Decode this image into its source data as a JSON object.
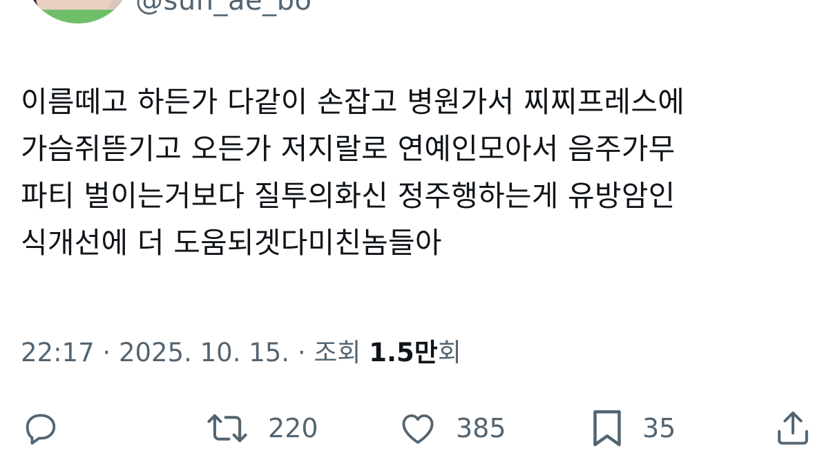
{
  "author": {
    "handle": "@sun_ae_bo"
  },
  "tweet": {
    "lines": [
      "이름떼고 하든가 다같이 손잡고 병원가서 찌찌프레스에",
      "가슴쥐뜯기고 오든가 저지랄로 연예인모아서 음주가무",
      "파티 벌이는거보다 질투의화신 정주행하는게 유방암인",
      "식개선에 더 도움되겟다미친놈들아"
    ]
  },
  "meta": {
    "time": "22:17",
    "separator": "·",
    "date": "2025. 10. 15.",
    "views_label": "조회",
    "views_number": "1.5",
    "views_unit_bold": "만",
    "views_suffix": "회"
  },
  "actions": {
    "reply_icon": "reply-icon",
    "retweet_icon": "retweet-icon",
    "retweet_count": "220",
    "like_icon": "heart-icon",
    "like_count": "385",
    "bookmark_icon": "bookmark-icon",
    "bookmark_count": "35",
    "share_icon": "share-icon"
  },
  "colors": {
    "text_primary": "#0f1419",
    "text_secondary": "#536471",
    "background": "#ffffff"
  }
}
